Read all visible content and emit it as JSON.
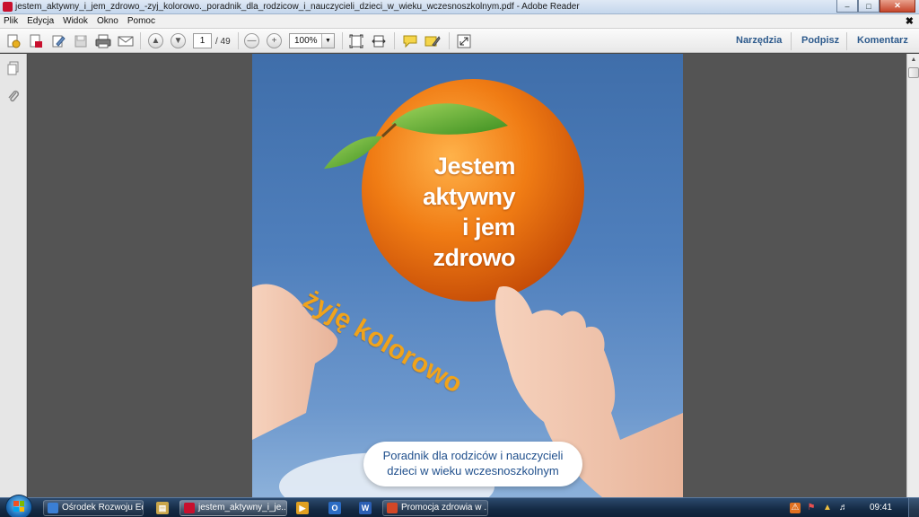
{
  "window": {
    "title": "jestem_aktywny_i_jem_zdrowo_-zyj_kolorowo._poradnik_dla_rodzicow_i_nauczycieli_dzieci_w_wieku_wczesnoszkolnym.pdf - Adobe Reader",
    "min": "–",
    "max": "□",
    "close": "✕"
  },
  "menu": {
    "items": [
      "Plik",
      "Edycja",
      "Widok",
      "Okno",
      "Pomoc"
    ],
    "doc_close": "✖"
  },
  "toolbar": {
    "page_current": "1",
    "page_total": "/ 49",
    "zoom": "100%",
    "zoom_arrow": "▼",
    "links": [
      "Narzędzia",
      "Podpisz",
      "Komentarz"
    ]
  },
  "document": {
    "title_lines": [
      "Jestem",
      "aktywny",
      "i jem",
      "zdrowo"
    ],
    "slogan": "żyję kolorowo",
    "subtitle_line1": "Poradnik dla rodziców i nauczycieli",
    "subtitle_line2": "dzieci w wieku wczesnoszkolnym"
  },
  "taskbar": {
    "tasks": [
      {
        "label": "Ośrodek Rozwoju Ed...",
        "color": "#3b7fd4"
      },
      {
        "label": "jestem_aktywny_i_je...",
        "color": "#c8102e"
      },
      {
        "label": "Promocja zdrowia w ...",
        "color": "#d24726"
      }
    ],
    "quick": [
      {
        "glyph": "▶",
        "color": "#e0a020"
      },
      {
        "glyph": "O",
        "color": "#2b6cc4"
      },
      {
        "glyph": "W",
        "color": "#2b5fb4"
      }
    ],
    "clock": "09:41"
  },
  "colors": {
    "accent_link": "#2d5a8c",
    "slogan": "#f0a31b",
    "sky": "#4f7fbc",
    "orange": "#f07c14"
  }
}
